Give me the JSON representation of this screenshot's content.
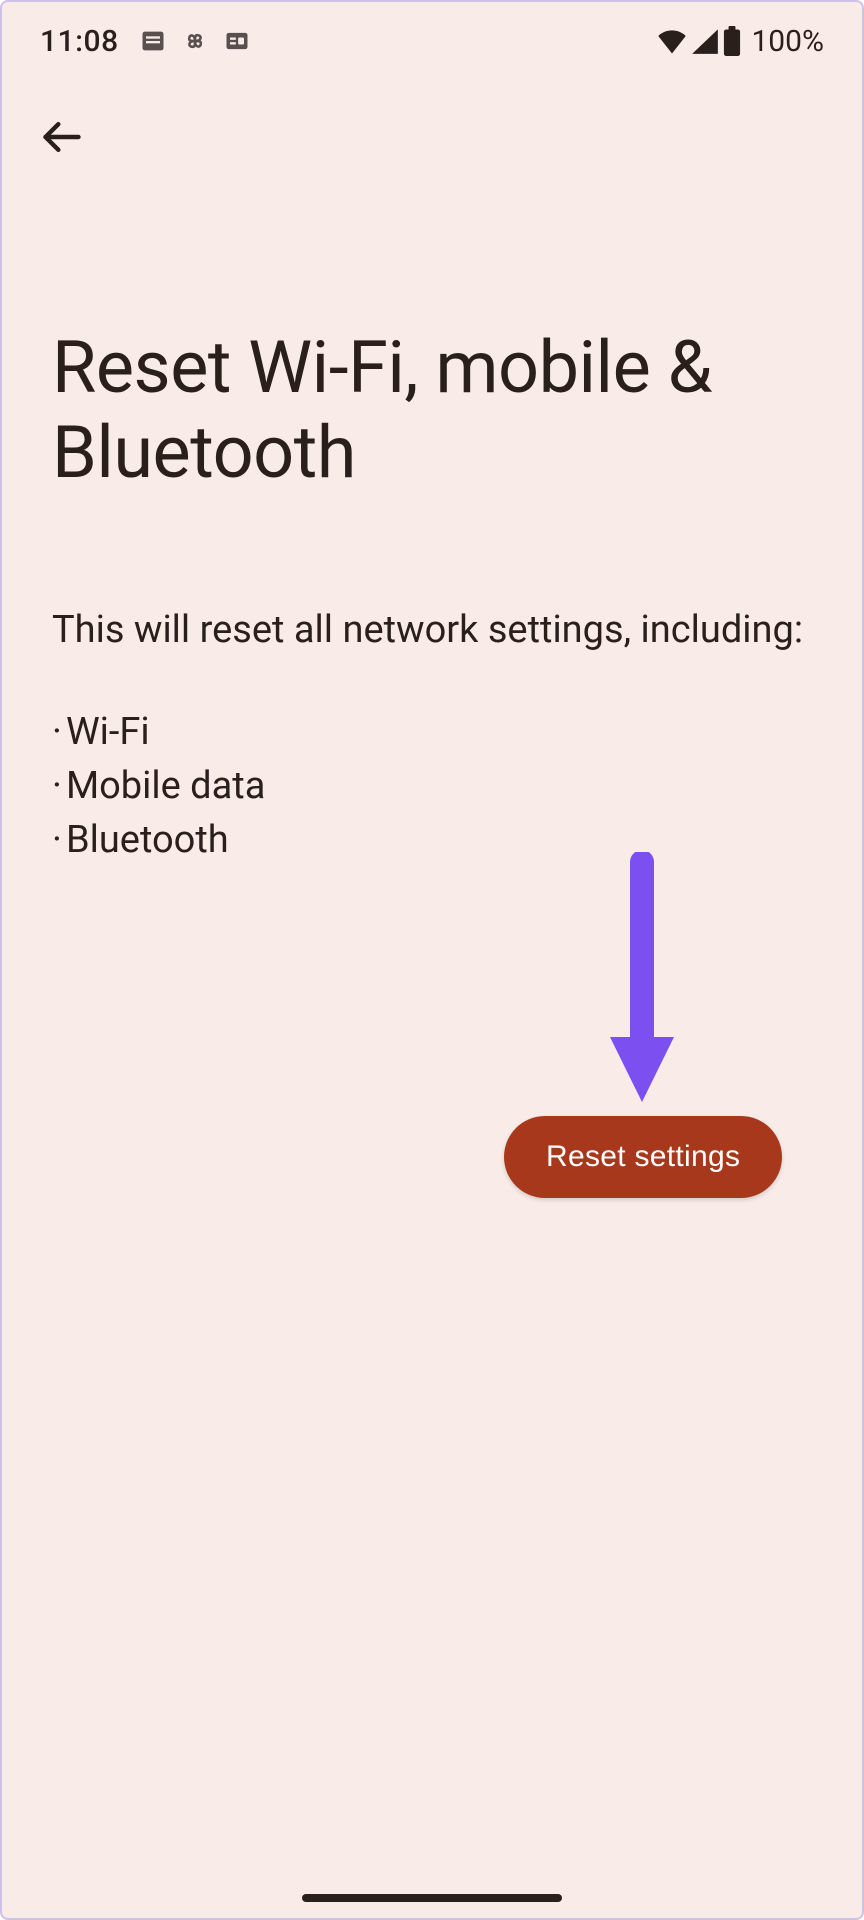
{
  "statusBar": {
    "time": "11:08",
    "batteryText": "100%"
  },
  "page": {
    "title": "Reset Wi-Fi, mobile & Bluetooth",
    "description": "This will reset all network settings, including:",
    "bullets": {
      "item0": "Wi-Fi",
      "item1": "Mobile data",
      "item2": "Bluetooth"
    }
  },
  "buttons": {
    "reset": "Reset settings"
  },
  "colors": {
    "background": "#f9ece8",
    "text": "#2b1f1c",
    "buttonBg": "#a7381c",
    "buttonText": "#ffffff",
    "annotation": "#7b4ff0"
  }
}
